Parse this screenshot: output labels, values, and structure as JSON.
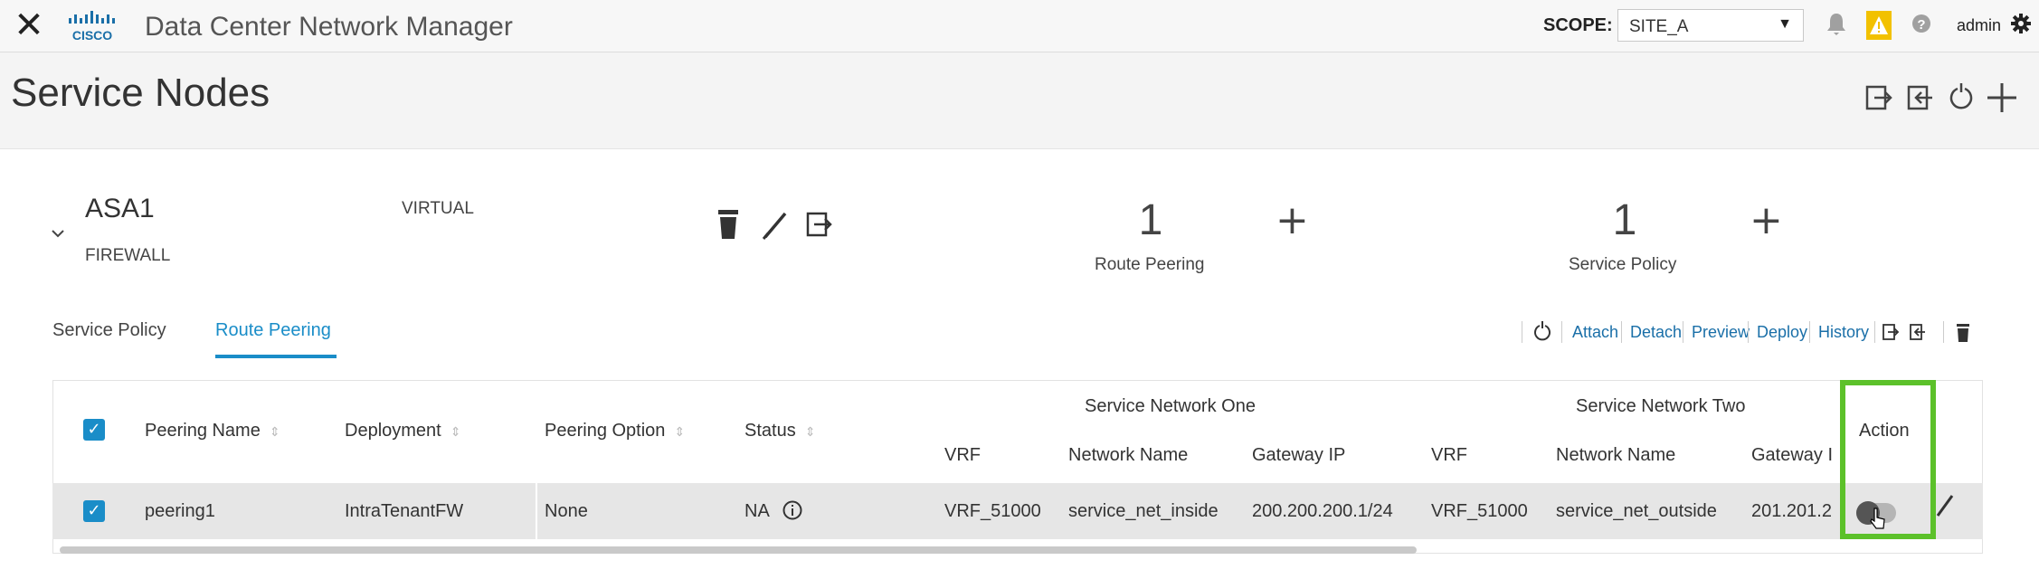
{
  "header": {
    "close_glyph": "✕",
    "logo_text": "CISCO",
    "app_title": "Data Center Network Manager",
    "scope_label": "SCOPE:",
    "scope_value": "SITE_A",
    "scope_caret": "▼",
    "icons": [
      "bell-icon",
      "warning-icon",
      "help-icon",
      "settings-icon"
    ],
    "user": "admin",
    "colors": {
      "warning": "#f2c100"
    }
  },
  "page": {
    "title": "Service Nodes",
    "action_icons": [
      "import-icon",
      "export-icon",
      "refresh-icon",
      "add-icon"
    ]
  },
  "node": {
    "name": "ASA1",
    "type": "FIREWALL",
    "form_factor": "VIRTUAL",
    "route_peering_count": "1",
    "route_peering_label": "Route Peering",
    "service_policy_count": "1",
    "service_policy_label": "Service Policy",
    "plus_glyph": "+"
  },
  "tabs": {
    "inactive": "Service Policy",
    "active": "Route Peering",
    "accent": "#1a8dc8"
  },
  "table_actions": {
    "attach": "Attach",
    "detach": "Detach",
    "preview": "Preview",
    "deploy": "Deploy",
    "history": "History"
  },
  "table": {
    "headers": {
      "peering_name": "Peering Name",
      "deployment": "Deployment",
      "peering_option": "Peering Option",
      "status": "Status",
      "group_one": "Service Network One",
      "group_two": "Service Network Two",
      "vrf": "VRF",
      "network_name": "Network Name",
      "gateway_ip": "Gateway IP",
      "gateway_ip_truncated": "Gateway I",
      "action": "Action"
    },
    "sort_glyph": "⇕",
    "rows": [
      {
        "peering_name": "peering1",
        "deployment": "IntraTenantFW",
        "peering_option": "None",
        "status": "NA",
        "vrf_one": "VRF_51000",
        "network_one": "service_net_inside",
        "gateway_one": "200.200.200.1/24",
        "vrf_two": "VRF_51000",
        "network_two": "service_net_outside",
        "gateway_two": "201.201.2"
      }
    ],
    "highlight_color": "#5cc12a"
  }
}
